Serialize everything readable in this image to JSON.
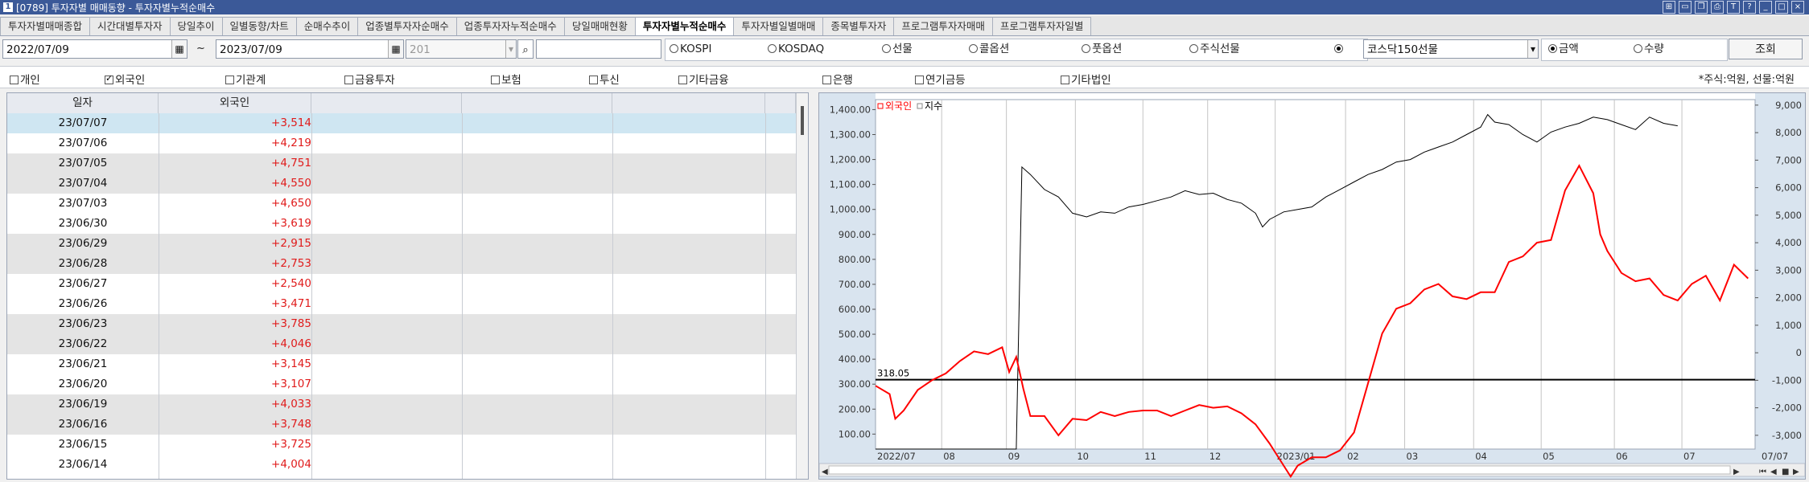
{
  "window": {
    "title": "[0789] 투자자별 매매동향 - 투자자별누적순매수",
    "app_badge": "1"
  },
  "tabs": [
    {
      "label": "투자자별매매종합"
    },
    {
      "label": "시간대별투자자"
    },
    {
      "label": "당일추이"
    },
    {
      "label": "일별동향/차트"
    },
    {
      "label": "순매수추이"
    },
    {
      "label": "업종별투자자순매수"
    },
    {
      "label": "업종투자자누적순매수"
    },
    {
      "label": "당일매매현황"
    },
    {
      "label": "투자자별누적순매수",
      "active": true
    },
    {
      "label": "투자자별일별매매"
    },
    {
      "label": "종목별투자자"
    },
    {
      "label": "프로그램투자자매매"
    },
    {
      "label": "프로그램투자자일별"
    }
  ],
  "controls": {
    "date_from": "2022/07/09",
    "tilde": "~",
    "date_to": "2023/07/09",
    "code_value": "201",
    "search_value": "",
    "market_radios": [
      {
        "label": "KOSPI",
        "selected": false
      },
      {
        "label": "KOSDAQ",
        "selected": false
      },
      {
        "label": "선물",
        "selected": false
      },
      {
        "label": "콜옵션",
        "selected": false
      },
      {
        "label": "풋옵션",
        "selected": false
      },
      {
        "label": "주식선물",
        "selected": false
      },
      {
        "label": "",
        "selected": true
      }
    ],
    "futures_select": "코스닥150선물",
    "amount_radios": [
      {
        "label": "금액",
        "selected": true
      },
      {
        "label": "수량",
        "selected": false
      }
    ],
    "query_button": "조회"
  },
  "investor_checks": [
    {
      "label": "개인",
      "checked": false
    },
    {
      "label": "외국인",
      "checked": true
    },
    {
      "label": "기관계",
      "checked": false
    },
    {
      "label": "금융투자",
      "checked": false
    },
    {
      "label": "보험",
      "checked": false
    },
    {
      "label": "투신",
      "checked": false
    },
    {
      "label": "기타금융",
      "checked": false
    },
    {
      "label": "은행",
      "checked": false
    },
    {
      "label": "연기금등",
      "checked": false
    },
    {
      "label": "기타법인",
      "checked": false
    }
  ],
  "unit_note": "*주식:억원, 선물:억원",
  "table": {
    "headers": [
      "일자",
      "외국인"
    ],
    "rows": [
      [
        "23/07/07",
        "+3,514"
      ],
      [
        "23/07/06",
        "+4,219"
      ],
      [
        "23/07/05",
        "+4,751"
      ],
      [
        "23/07/04",
        "+4,550"
      ],
      [
        "23/07/03",
        "+4,650"
      ],
      [
        "23/06/30",
        "+3,619"
      ],
      [
        "23/06/29",
        "+2,915"
      ],
      [
        "23/06/28",
        "+2,753"
      ],
      [
        "23/06/27",
        "+2,540"
      ],
      [
        "23/06/26",
        "+3,471"
      ],
      [
        "23/06/23",
        "+3,785"
      ],
      [
        "23/06/22",
        "+4,046"
      ],
      [
        "23/06/21",
        "+3,145"
      ],
      [
        "23/06/20",
        "+3,107"
      ],
      [
        "23/06/19",
        "+4,033"
      ],
      [
        "23/06/16",
        "+3,748"
      ],
      [
        "23/06/15",
        "+3,725"
      ],
      [
        "23/06/14",
        "+4,004"
      ]
    ]
  },
  "colors": {
    "foreign_line": "#ff0000",
    "index_line": "#000000",
    "selected_row": "#cfe6f2",
    "shaded_row": "#e4e4e4"
  },
  "chart_data": {
    "type": "line",
    "legend": [
      "외국인",
      "지수"
    ],
    "x_tick_labels": [
      "2022/07",
      "08",
      "09",
      "10",
      "11",
      "12",
      "2023/01",
      "02",
      "03",
      "04",
      "05",
      "06",
      "07"
    ],
    "x_corner_label": "07/07",
    "y_left_ticks": [
      "1,400.00",
      "1,300.00",
      "1,200.00",
      "1,100.00",
      "1,000.00",
      "900.00",
      "800.00",
      "700.00",
      "600.00",
      "500.00",
      "400.00",
      "300.00",
      "200.00",
      "100.00"
    ],
    "y_left_range": [
      40,
      1440
    ],
    "y_right_ticks": [
      "9,000",
      "8,000",
      "7,000",
      "6,000",
      "5,000",
      "4,000",
      "3,000",
      "2,000",
      "1,000",
      "0",
      "-1,000",
      "-2,000",
      "-3,000"
    ],
    "y_right_range": [
      -3500,
      9200
    ],
    "reference_value": 318.05,
    "reference_label": "318.05",
    "index_series": [
      [
        0,
        40
      ],
      [
        9,
        40
      ],
      [
        10,
        40
      ],
      [
        10.4,
        1170
      ],
      [
        11,
        1140
      ],
      [
        12,
        1080
      ],
      [
        13,
        1050
      ],
      [
        14,
        985
      ],
      [
        15,
        970
      ],
      [
        16,
        990
      ],
      [
        17,
        985
      ],
      [
        18,
        1010
      ],
      [
        19,
        1020
      ],
      [
        20,
        1035
      ],
      [
        21,
        1050
      ],
      [
        22,
        1075
      ],
      [
        23,
        1060
      ],
      [
        24,
        1065
      ],
      [
        25,
        1040
      ],
      [
        26,
        1025
      ],
      [
        27,
        985
      ],
      [
        27.5,
        930
      ],
      [
        28,
        960
      ],
      [
        29,
        990
      ],
      [
        30,
        1000
      ],
      [
        31,
        1010
      ],
      [
        32,
        1050
      ],
      [
        33,
        1080
      ],
      [
        34,
        1110
      ],
      [
        35,
        1140
      ],
      [
        36,
        1160
      ],
      [
        37,
        1190
      ],
      [
        38,
        1200
      ],
      [
        39,
        1230
      ],
      [
        40,
        1250
      ],
      [
        41,
        1270
      ],
      [
        42,
        1300
      ],
      [
        43,
        1330
      ],
      [
        43.5,
        1380
      ],
      [
        44,
        1350
      ],
      [
        45,
        1340
      ],
      [
        46,
        1300
      ],
      [
        47,
        1270
      ],
      [
        48,
        1310
      ],
      [
        49,
        1330
      ],
      [
        50,
        1345
      ],
      [
        51,
        1370
      ],
      [
        52,
        1360
      ],
      [
        53,
        1340
      ],
      [
        54,
        1320
      ],
      [
        55,
        1370
      ],
      [
        56,
        1345
      ],
      [
        57,
        1335
      ]
    ],
    "foreign_series": [
      [
        0,
        3800
      ],
      [
        1,
        3500
      ],
      [
        1.4,
        2600
      ],
      [
        2,
        2900
      ],
      [
        3,
        3650
      ],
      [
        4,
        4000
      ],
      [
        5,
        4250
      ],
      [
        6,
        4700
      ],
      [
        7,
        5050
      ],
      [
        8,
        4950
      ],
      [
        9,
        5200
      ],
      [
        9.5,
        4300
      ],
      [
        10,
        4850
      ],
      [
        10.5,
        3700
      ],
      [
        11,
        2700
      ],
      [
        12,
        2700
      ],
      [
        13,
        2000
      ],
      [
        14,
        2600
      ],
      [
        15,
        2550
      ],
      [
        16,
        2850
      ],
      [
        17,
        2700
      ],
      [
        18,
        2850
      ],
      [
        19,
        2900
      ],
      [
        20,
        2900
      ],
      [
        21,
        2700
      ],
      [
        22,
        2900
      ],
      [
        23,
        3100
      ],
      [
        24,
        3000
      ],
      [
        25,
        3050
      ],
      [
        26,
        2800
      ],
      [
        27,
        2400
      ],
      [
        28,
        1700
      ],
      [
        29,
        900
      ],
      [
        29.5,
        500
      ],
      [
        30,
        900
      ],
      [
        31,
        1200
      ],
      [
        32,
        1200
      ],
      [
        33,
        1450
      ],
      [
        34,
        2100
      ],
      [
        35,
        3900
      ],
      [
        36,
        5700
      ],
      [
        37,
        6600
      ],
      [
        38,
        6800
      ],
      [
        39,
        7300
      ],
      [
        40,
        7500
      ],
      [
        41,
        7050
      ],
      [
        42,
        6950
      ],
      [
        43,
        7200
      ],
      [
        44,
        7200
      ],
      [
        45,
        8300
      ],
      [
        46,
        8500
      ],
      [
        47,
        9000
      ],
      [
        48,
        9100
      ],
      [
        49,
        10900
      ],
      [
        50,
        11800
      ],
      [
        51,
        10800
      ],
      [
        51.5,
        9300
      ],
      [
        52,
        8700
      ],
      [
        53,
        7900
      ],
      [
        54,
        7600
      ],
      [
        55,
        7700
      ],
      [
        56,
        7100
      ],
      [
        57,
        6900
      ],
      [
        58,
        7500
      ],
      [
        59,
        7800
      ],
      [
        60,
        6900
      ],
      [
        61,
        8200
      ],
      [
        62,
        7700
      ]
    ]
  }
}
